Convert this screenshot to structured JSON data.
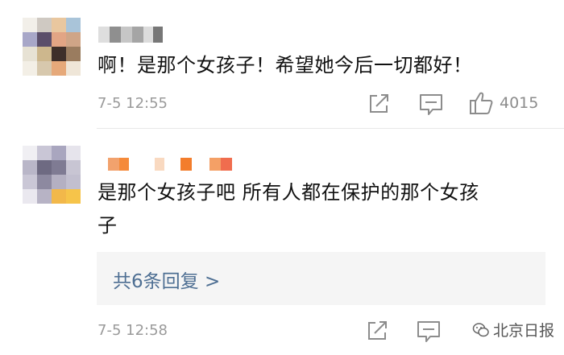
{
  "comments": [
    {
      "text": "啊！是那个女孩子！希望她今后一切都好！",
      "time": "7-5 12:55",
      "like_count": "4015"
    },
    {
      "text_line1": "是那个女孩子吧 所有人都在保护的那个女孩",
      "text_line2": "子",
      "replies_label": "共6条回复 >",
      "time": "7-5 12:58"
    }
  ],
  "watermark": "北京日报",
  "icons": {
    "share": "share-icon",
    "comment": "comment-icon",
    "like": "thumbs-up-icon"
  },
  "colors": {
    "link": "#4e6f93",
    "meta": "#9a9a9a",
    "reply_bg": "#f5f5f5"
  }
}
